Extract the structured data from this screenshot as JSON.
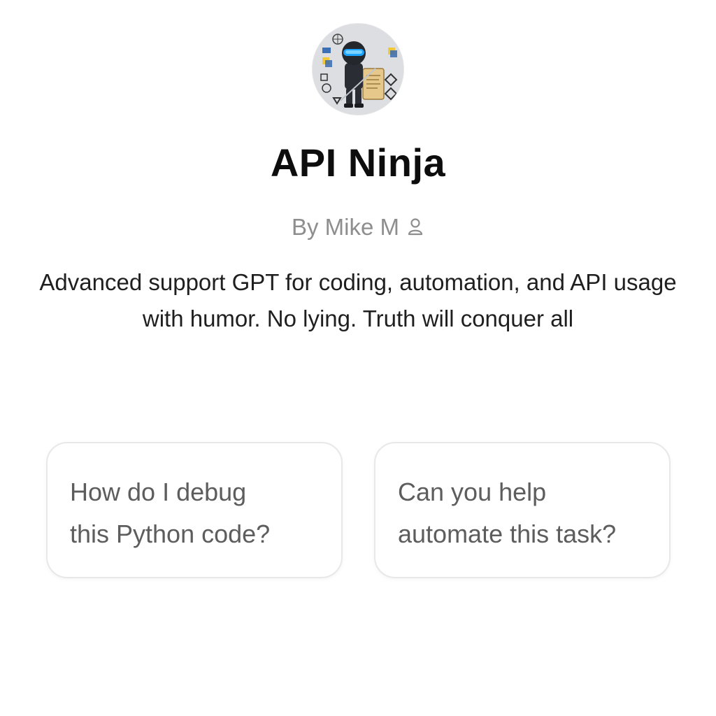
{
  "gpt": {
    "avatar_icon": "ninja-avatar",
    "title": "API Ninja",
    "author": "By Mike M",
    "author_icon": "person-icon",
    "description_line1": "Advanced support GPT for coding, automation, and API usage",
    "description_line2": "with humor. No lying. Truth will conquer all"
  },
  "starters": [
    {
      "line1": "How do I debug",
      "line2": "this Python code?"
    },
    {
      "line1": "Can you help",
      "line2": "automate this task?"
    }
  ],
  "colors": {
    "title": "#0d0d0d",
    "byline": "#8e8e8e",
    "description": "#1f1f1f",
    "starter_text": "#5d5d5d",
    "starter_border": "#e8e8e8"
  }
}
